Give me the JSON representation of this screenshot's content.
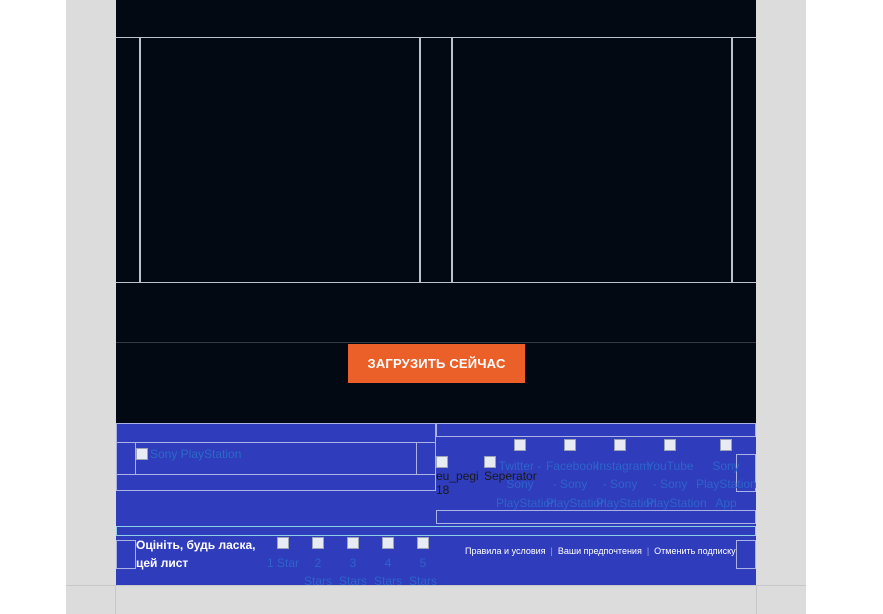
{
  "colors": {
    "page_bg": "#dcdcdc",
    "hero_bg": "#030913",
    "cta_bg": "#eb5f29",
    "footer_bg": "#2f3cbc"
  },
  "cta": {
    "label": "ЗАГРУЗИТЬ СЕЙЧАС"
  },
  "footer": {
    "logo_alt": "Sony PlayStation",
    "pegi_alt": "eu_pegi 18",
    "separator_alt": "Seperator",
    "social": [
      {
        "label": "Twitter - Sony PlayStation",
        "icon": "twitter-icon"
      },
      {
        "label": "Facebook - Sony PlayStation",
        "icon": "facebook-icon"
      },
      {
        "label": "Instagram - Sony PlayStation",
        "icon": "instagram-icon"
      },
      {
        "label": "YouTube - Sony PlayStation",
        "icon": "youtube-icon"
      },
      {
        "label": "Sony PlayStation App",
        "icon": "app-icon"
      }
    ]
  },
  "rating": {
    "label": "Оцініть, будь ласка, цей лист",
    "stars": [
      {
        "label": "1 Star"
      },
      {
        "label": "2 Stars"
      },
      {
        "label": "3 Stars"
      },
      {
        "label": "4 Stars"
      },
      {
        "label": "5 Stars"
      }
    ]
  },
  "links": {
    "terms": "Правила и условия",
    "preferences": "Ваши предпочтения",
    "unsubscribe": "Отменить подписку",
    "separator": "|"
  }
}
